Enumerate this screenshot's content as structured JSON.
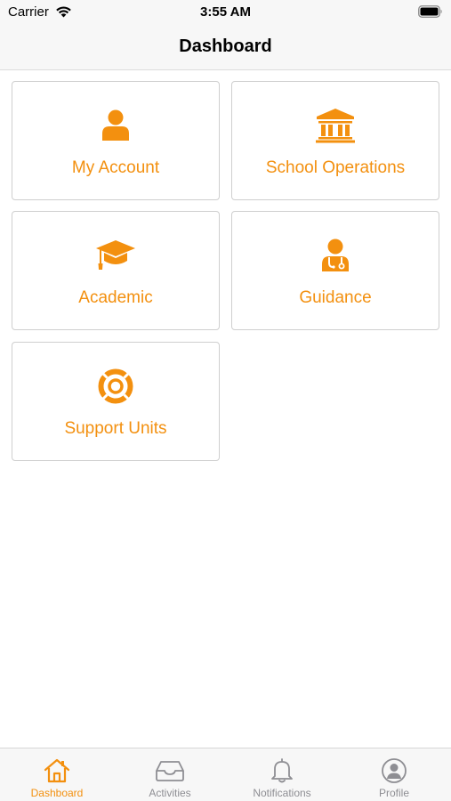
{
  "status_bar": {
    "carrier": "Carrier",
    "time": "3:55 AM"
  },
  "nav": {
    "title": "Dashboard"
  },
  "theme": {
    "accent": "#f3900f",
    "tab_inactive": "#8e8e93",
    "tile_border": "#cfcfcf"
  },
  "tiles": [
    {
      "label": "My Account",
      "icon": "user-icon"
    },
    {
      "label": "School Operations",
      "icon": "bank-building-icon"
    },
    {
      "label": "Academic",
      "icon": "graduation-cap-icon"
    },
    {
      "label": "Guidance",
      "icon": "doctor-stethoscope-icon"
    },
    {
      "label": "Support Units",
      "icon": "lifebuoy-icon"
    }
  ],
  "tab_bar": {
    "tabs": [
      {
        "label": "Dashboard",
        "icon": "home-icon",
        "active": true
      },
      {
        "label": "Activities",
        "icon": "inbox-tray-icon",
        "active": false
      },
      {
        "label": "Notifications",
        "icon": "bell-icon",
        "active": false
      },
      {
        "label": "Profile",
        "icon": "user-circle-icon",
        "active": false
      }
    ]
  }
}
